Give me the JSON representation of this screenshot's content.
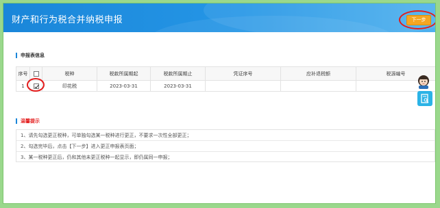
{
  "header": {
    "title": "财产和行为税合并纳税申报",
    "next_label": "下一步"
  },
  "declaration": {
    "section_title": "申报表信息",
    "columns": [
      "序号",
      "税种",
      "税款所属期起",
      "税款所属期止",
      "凭证序号",
      "应补退税额",
      "税源编号"
    ],
    "rows": [
      {
        "index": "1",
        "checked": true,
        "tax_type": "印花税",
        "period_start": "2023-03-31",
        "period_end": "2023-03-31",
        "voucher_no": "",
        "amount": "",
        "source_no": ""
      }
    ]
  },
  "tips": {
    "section_title": "温馨提示",
    "items": [
      "1、请先勾选更正税种，可单独勾选某一税种进行更正，不要求一次性全部更正；",
      "2、勾选完毕后，点击【下一步】进入更正申报表页面；",
      "3、某一税种更正后，仍和其他未更正税种一起显示，即仍属同一申报；"
    ]
  },
  "colors": {
    "header": "#1a86d9",
    "accent": "#f5a623",
    "highlight": "#e31b1b",
    "border": "#9ad88c"
  },
  "icons": {
    "assistant": "assistant-avatar-icon",
    "tool": "document-search-icon"
  }
}
